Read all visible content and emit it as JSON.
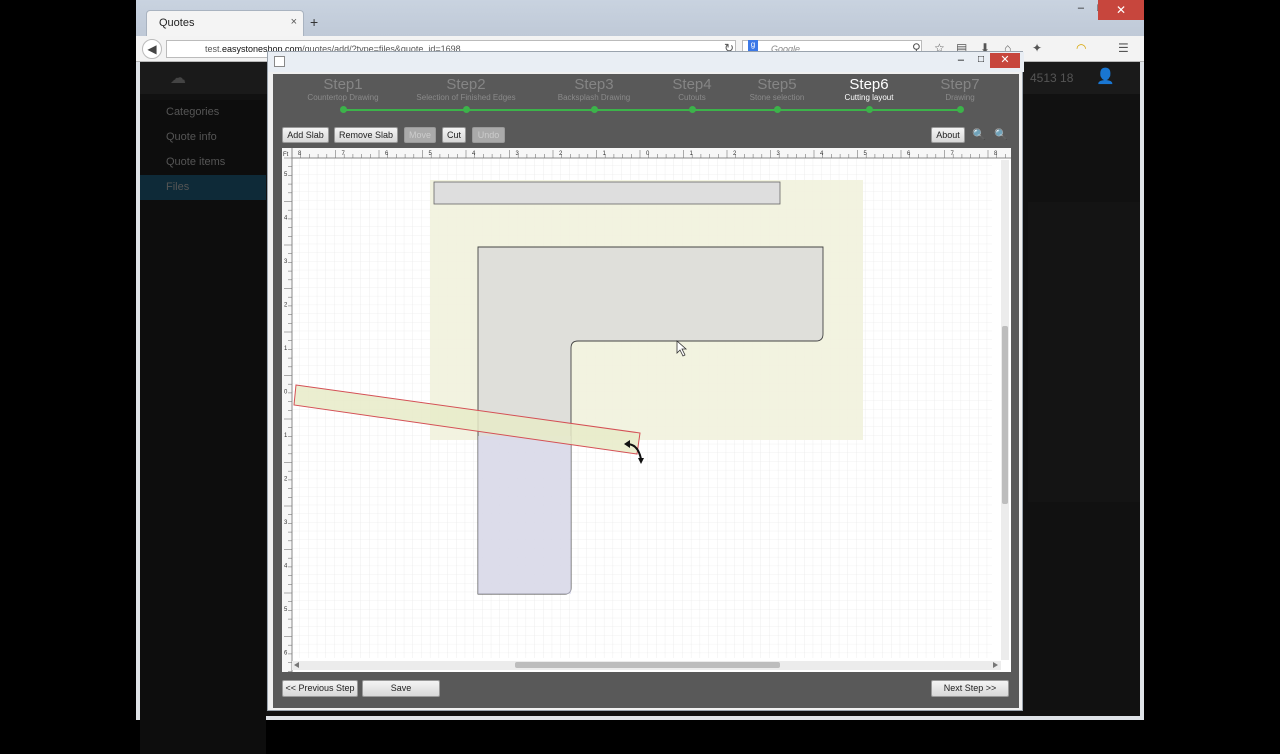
{
  "browser": {
    "tab_title": "Quotes",
    "tab_close": "×",
    "new_tab": "+",
    "url_prefix": "test.",
    "url_domain": "easystoneshop.com",
    "url_rest": "/quotes/add/?type=files&quote_id=1698",
    "search_placeholder": "Google",
    "search_engine_icon": "google-icon"
  },
  "window_controls": {
    "minimize": "–",
    "maximize": "□",
    "close": "✕"
  },
  "sidebar": {
    "items": [
      {
        "label": "Categories"
      },
      {
        "label": "Quote info"
      },
      {
        "label": "Quote items"
      },
      {
        "label": "Files"
      }
    ]
  },
  "header": {
    "number_fragment": "4513 18"
  },
  "dialog": {
    "close": "✕",
    "steps": [
      {
        "title": "Step1",
        "subtitle": "Countertop Drawing"
      },
      {
        "title": "Step2",
        "subtitle": "Selection of Finished Edges"
      },
      {
        "title": "Step3",
        "subtitle": "Backsplash Drawing"
      },
      {
        "title": "Step4",
        "subtitle": "Cutouts"
      },
      {
        "title": "Step5",
        "subtitle": "Stone selection"
      },
      {
        "title": "Step6",
        "subtitle": "Cutting layout"
      },
      {
        "title": "Step7",
        "subtitle": "Drawing"
      }
    ],
    "active_step": 6,
    "toolbar": {
      "add_slab": "Add Slab",
      "remove_slab": "Remove Slab",
      "move": "Move",
      "cut": "Cut",
      "undo": "Undo",
      "about": "About"
    },
    "ruler": {
      "corner": "Ft",
      "x_labels": [
        "8",
        "7",
        "6",
        "5",
        "4",
        "3",
        "2",
        "1",
        "0",
        "1",
        "2",
        "3",
        "4",
        "5",
        "6",
        "7",
        "8"
      ],
      "y_labels": [
        "5",
        "4",
        "3",
        "2",
        "1",
        "0",
        "1",
        "2",
        "3",
        "4",
        "5",
        "6"
      ]
    },
    "footer": {
      "prev": "<< Previous Step",
      "save": "Save",
      "next": "Next Step >>"
    }
  }
}
